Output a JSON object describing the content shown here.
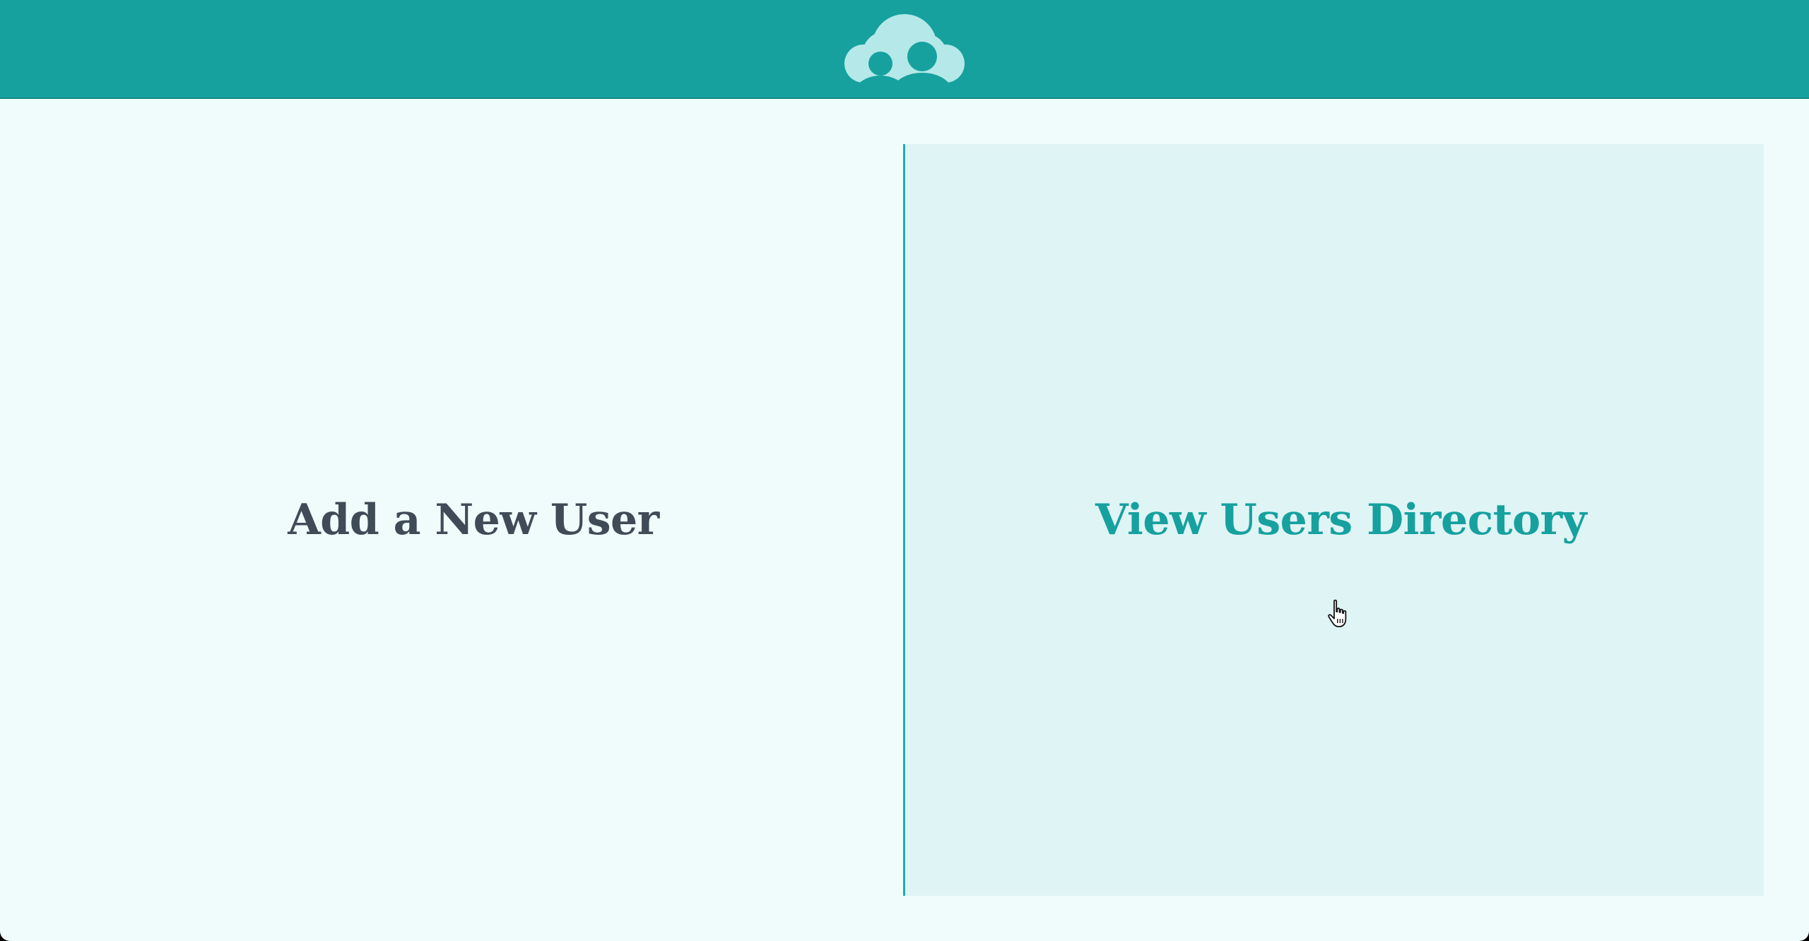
{
  "header": {
    "logo_icon": "users-cloud-icon",
    "background_color": "#16a19f",
    "logo_light_color": "#b5e8e8",
    "logo_dark_color": "#16a19f"
  },
  "main": {
    "add_user_label": "Add a New User",
    "view_directory_label": "View Users Directory",
    "add_user_color": "#3f4b57",
    "view_directory_color": "#16a19f",
    "active_panel_bg": "#dff4f5"
  },
  "cursor": {
    "icon": "hand-pointer-icon"
  }
}
